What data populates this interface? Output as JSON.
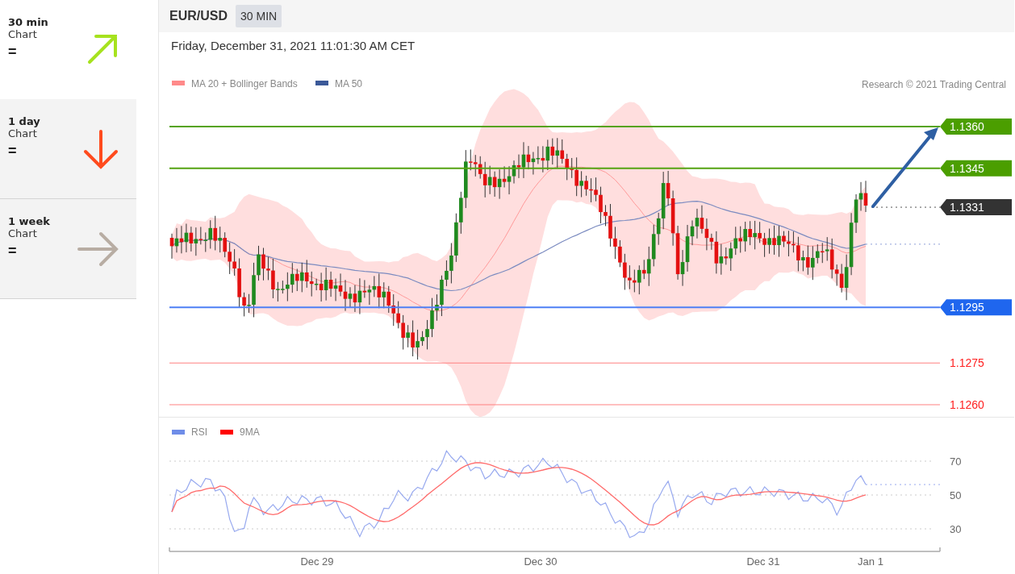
{
  "sidebar": {
    "items": [
      {
        "title": "30 min",
        "subtitle": "Chart",
        "signal": "=",
        "kind": "up",
        "selected": true
      },
      {
        "title": "1 day",
        "subtitle": "Chart",
        "signal": "=",
        "kind": "down",
        "selected": false
      },
      {
        "title": "1 week",
        "subtitle": "Chart",
        "signal": "=",
        "kind": "flat",
        "selected": false
      }
    ]
  },
  "header": {
    "symbol": "EUR/USD",
    "tabs": [
      {
        "label": "30 MIN",
        "selected": true
      }
    ]
  },
  "timestamp": "Friday, December 31, 2021 11:01:30 AM CET",
  "price_chart": {
    "legend": [
      {
        "label": "MA 20 + Bollinger Bands",
        "color": "#ff8a8a"
      },
      {
        "label": "MA 50",
        "color": "#3b5998"
      }
    ],
    "credit": "Research © 2021 Trading Central",
    "levels": [
      {
        "label": "1.1360",
        "kind": "resistance"
      },
      {
        "label": "1.1345",
        "kind": "resistance"
      },
      {
        "label": "1.1331",
        "kind": "last"
      },
      {
        "label": "1.1295",
        "kind": "support"
      },
      {
        "label": "1.1275",
        "kind": "minor"
      },
      {
        "label": "1.1260",
        "kind": "minor"
      }
    ]
  },
  "rsi_chart": {
    "legend": [
      {
        "label": "RSI",
        "color": "#6f8de8"
      },
      {
        "label": "9MA",
        "color": "#ff0000"
      }
    ],
    "yticks": [
      "70",
      "50",
      "30"
    ],
    "xticks": [
      "Dec 29",
      "Dec 30",
      "Dec 31",
      "Jan 1"
    ]
  }
}
